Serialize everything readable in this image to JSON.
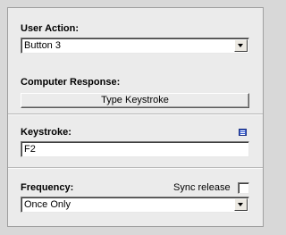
{
  "user_action": {
    "label": "User Action:",
    "value": "Button 3"
  },
  "computer_response": {
    "label": "Computer Response:",
    "button_label": "Type Keystroke"
  },
  "keystroke": {
    "label": "Keystroke:",
    "value": "F2",
    "icon": "list-icon"
  },
  "frequency": {
    "label": "Frequency:",
    "value": "Once Only",
    "sync_release_label": "Sync release",
    "sync_release_checked": false
  }
}
